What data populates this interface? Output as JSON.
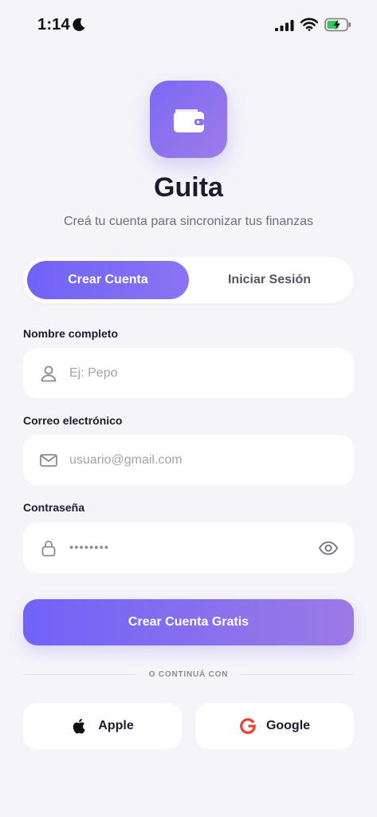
{
  "status_bar": {
    "time": "1:14",
    "icons": [
      "moon-icon",
      "signal-icon",
      "wifi-icon",
      "battery-charging-icon"
    ]
  },
  "app": {
    "logo_icon": "wallet-icon",
    "title": "Guita",
    "subtitle": "Creá tu cuenta para sincronizar tus finanzas"
  },
  "tabs": {
    "active": "Crear Cuenta",
    "inactive": "Iniciar Sesión"
  },
  "form": {
    "name": {
      "label": "Nombre completo",
      "placeholder": "Ej: Pepo",
      "value": "",
      "icon": "user-icon"
    },
    "email": {
      "label": "Correo electrónico",
      "placeholder": "usuario@gmail.com",
      "value": "",
      "icon": "mail-icon"
    },
    "password": {
      "label": "Contraseña",
      "value": "••••••••",
      "icon": "lock-icon",
      "toggle_icon": "eye-icon"
    },
    "submit": "Crear Cuenta Gratis"
  },
  "social": {
    "divider": "O CONTINUÁ CON",
    "apple": "Apple",
    "google": "Google"
  },
  "colors": {
    "background": "#f5f4f9",
    "accent_start": "#6f63f7",
    "accent_end": "#9c7ae6",
    "text": "#1c1c2e",
    "muted": "#6d6d7d",
    "google_red": "#ea4335"
  }
}
